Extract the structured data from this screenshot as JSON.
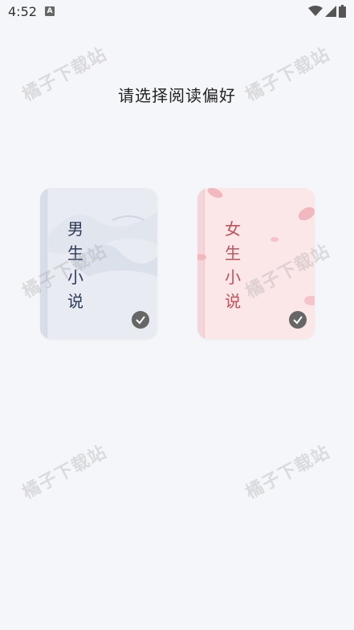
{
  "status_bar": {
    "time": "4:52",
    "a_badge": "A",
    "icons": [
      "wifi-icon",
      "signal-icon",
      "battery-icon"
    ]
  },
  "page": {
    "title": "请选择阅读偏好"
  },
  "cards": [
    {
      "label": "男生小说",
      "selected": true,
      "accent": "#2c3a55"
    },
    {
      "label": "女生小说",
      "selected": true,
      "accent": "#c0545c"
    }
  ],
  "watermark": "橘子下载站",
  "colors": {
    "background": "#f5f6fa",
    "male_card": "#e8ebf2",
    "female_card": "#fbe6e8",
    "check": "#666666"
  }
}
